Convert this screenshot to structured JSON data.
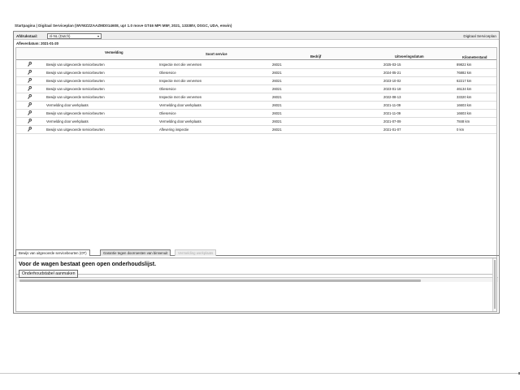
{
  "breadcrumb": "Startpagina | Digitaal Serviceplan (WVWZZZAAZMD014608, up! 1.0 move GT46 MPI M5F, 2021, 1333BV, DSGC, UDA, enwin)",
  "toolbar": {
    "language_label": "Afdrukstaal:",
    "language_value": "nl-NL (Dutch)",
    "panel_title": "Digitaal Serviceplan"
  },
  "afr_date": "Afleverdatum: 2021-01-20",
  "table": {
    "headers": {
      "vermelding": "Vermelding",
      "soort": "Soort service",
      "bedrijf": "Bedrijf",
      "datum": "Uitvoeringsdatum",
      "km": "Kilometerstand"
    },
    "rows": [
      {
        "has_icon": true,
        "vermelding": "Bewijs van uitgevoerde servicebeurten",
        "soort": "Inspectie met olie verversen",
        "bedrijf": "26021",
        "datum": "2025-03-15",
        "km": "89822 km"
      },
      {
        "has_icon": true,
        "vermelding": "Bewijs van uitgevoerde servicebeurten",
        "soort": "Olieservice",
        "bedrijf": "26021",
        "datum": "2024-05-21",
        "km": "76882 km"
      },
      {
        "has_icon": true,
        "vermelding": "Bewijs van uitgevoerde servicebeurten",
        "soort": "Inspectie met olie verversen",
        "bedrijf": "26021",
        "datum": "2023-10-02",
        "km": "62217 km"
      },
      {
        "has_icon": true,
        "vermelding": "Bewijs van uitgevoerde servicebeurten",
        "soort": "Olieservice",
        "bedrijf": "26021",
        "datum": "2023-01-18",
        "km": "46134 km"
      },
      {
        "has_icon": true,
        "vermelding": "Bewijs van uitgevoerde servicebeurten",
        "soort": "Inspectie met olie verversen",
        "bedrijf": "26021",
        "datum": "2022-08-13",
        "km": "33320 km"
      },
      {
        "has_icon": true,
        "vermelding": "Vermelding door werkplaats",
        "soort": "Vermelding door werkplaats",
        "bedrijf": "26021",
        "datum": "2021-11-09",
        "km": "16603 km"
      },
      {
        "has_icon": true,
        "vermelding": "Bewijs van uitgevoerde servicebeurten",
        "soort": "Olieservice",
        "bedrijf": "26021",
        "datum": "2021-11-09",
        "km": "16603 km"
      },
      {
        "has_icon": true,
        "vermelding": "Vermelding door werkplaats",
        "soort": "Vermelding door werkplaats",
        "bedrijf": "26021",
        "datum": "2021-07-09",
        "km": "7848 km"
      },
      {
        "has_icon": true,
        "vermelding": "Bewijs van uitgevoerde servicebeurten",
        "soort": "Aflevering inspectie",
        "bedrijf": "26021",
        "datum": "2021-01-07",
        "km": "0 km"
      }
    ]
  },
  "tabs": [
    {
      "label": "Bewijs van uitgevoerde servicebeurten (OT)",
      "state": "active"
    },
    {
      "label": "Garantie tegen doorroesten van binnenuit",
      "state": "normal"
    },
    {
      "label": "Vermelding werkplaats",
      "state": "disabled"
    }
  ],
  "lower": {
    "message": "Voor de wagen bestaat geen open onderhoudslijst.",
    "button_label": "Onderhoudstabel aanmaken"
  },
  "icons": {
    "row_icon": "key-icon",
    "dropdown": "chevron-down-icon"
  }
}
